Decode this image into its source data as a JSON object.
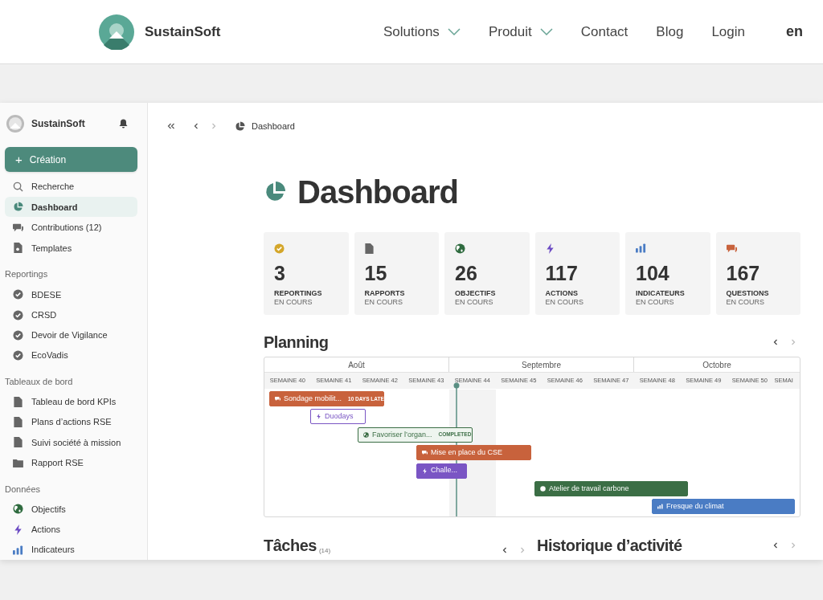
{
  "site_nav": {
    "brand": "SustainSoft",
    "links": [
      {
        "label": "Solutions",
        "dropdown": true
      },
      {
        "label": "Produit",
        "dropdown": true
      },
      {
        "label": "Contact",
        "dropdown": false
      },
      {
        "label": "Blog",
        "dropdown": false
      },
      {
        "label": "Login",
        "dropdown": false
      }
    ],
    "language": "en"
  },
  "sidebar": {
    "workspace": "SustainSoft",
    "create_button": {
      "icon_text": "+",
      "label": "Création"
    },
    "items": [
      {
        "label": "Recherche",
        "kind": "search",
        "selected": false
      },
      {
        "label": "Dashboard",
        "kind": "pie",
        "selected": true
      },
      {
        "label": "Contributions (12)",
        "kind": "chat",
        "selected": false
      },
      {
        "label": "Templates",
        "kind": "template",
        "selected": false
      }
    ],
    "sections": [
      {
        "title": "Reportings",
        "items": [
          {
            "label": "BDESE",
            "kind": "badge"
          },
          {
            "label": "CRSD",
            "kind": "badge"
          },
          {
            "label": "Devoir de Vigilance",
            "kind": "badge"
          },
          {
            "label": "EcoVadis",
            "kind": "badge"
          }
        ]
      },
      {
        "title": "Tableaux de bord",
        "items": [
          {
            "label": "Tableau de bord KPIs",
            "kind": "file"
          },
          {
            "label": "Plans d’actions RSE",
            "kind": "file"
          },
          {
            "label": "Suivi société à mission",
            "kind": "file"
          },
          {
            "label": "Rapport RSE",
            "kind": "folder"
          }
        ]
      },
      {
        "title": "Données",
        "items": [
          {
            "label": "Objectifs",
            "kind": "globe"
          },
          {
            "label": "Actions",
            "kind": "bolt"
          },
          {
            "label": "Indicateurs",
            "kind": "bars"
          }
        ]
      }
    ]
  },
  "breadcrumb": {
    "current": "Dashboard"
  },
  "page_title": "Dashboard",
  "stats": [
    {
      "value": "3",
      "label": "REPORTINGS",
      "sublabel": "EN COURS",
      "kind": "badge"
    },
    {
      "value": "15",
      "label": "RAPPORTS",
      "sublabel": "EN COURS",
      "kind": "file"
    },
    {
      "value": "26",
      "label": "OBJECTIFS",
      "sublabel": "EN COURS",
      "kind": "globe"
    },
    {
      "value": "117",
      "label": "ACTIONS",
      "sublabel": "EN COURS",
      "kind": "bolt"
    },
    {
      "value": "104",
      "label": "INDICATEURS",
      "sublabel": "EN COURS",
      "kind": "bars"
    },
    {
      "value": "167",
      "label": "QUESTIONS",
      "sublabel": "EN COURS",
      "kind": "chat"
    }
  ],
  "planning": {
    "title": "Planning",
    "months": [
      "Août",
      "Septembre",
      "Octobre"
    ],
    "weeks": [
      "SEMAINE 40",
      "SEMAINE 41",
      "SEMAINE 42",
      "SEMAINE 43",
      "SEMAINE 44",
      "SEMAINE 45",
      "SEMAINE 46",
      "SEMAINE 47",
      "SEMAINE 48",
      "SEMAINE 49",
      "SEMAINE 50",
      "SEMAI"
    ],
    "bars": [
      {
        "label": "Sondage mobilit...",
        "kind": "chat",
        "color": "#c8623c",
        "filled": true,
        "badge": "10 DAYS LATE"
      },
      {
        "label": "Duodays",
        "kind": "bolt",
        "color": "#7a55c4",
        "filled": false
      },
      {
        "label": "Favoriser l’organ...",
        "kind": "globe",
        "color": "#3b6e45",
        "filled": false,
        "badge": "COMPLETED"
      },
      {
        "label": "Mise en place du CSE",
        "kind": "chat",
        "color": "#c8623c",
        "filled": true
      },
      {
        "label": "Challe...",
        "kind": "bolt",
        "color": "#7a55c4",
        "filled": true
      },
      {
        "label": "Atelier de travail carbone",
        "kind": "globe",
        "color": "#3b6e45",
        "filled": true
      },
      {
        "label": "Fresque du climat",
        "kind": "bars",
        "color": "#4a7cc4",
        "filled": true
      }
    ]
  },
  "tasks": {
    "title": "Tâches",
    "count": "(14)"
  },
  "activity": {
    "title": "Historique d’activité"
  }
}
